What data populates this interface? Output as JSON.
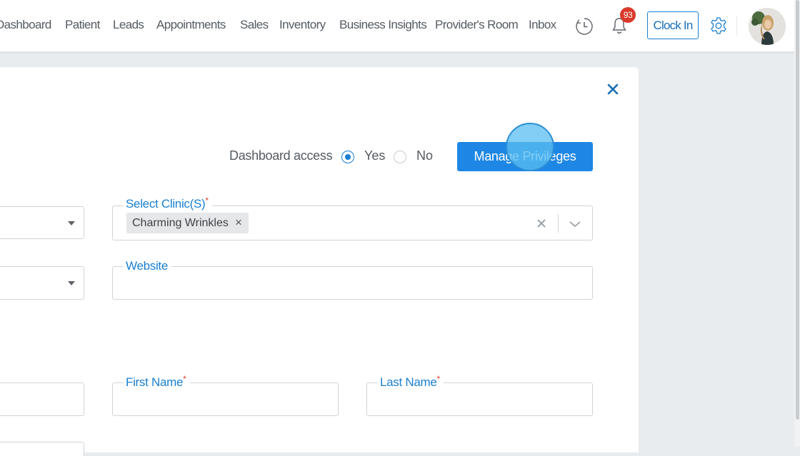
{
  "nav": {
    "items": [
      {
        "id": "dashboard",
        "label": "Dashboard"
      },
      {
        "id": "patient",
        "label": "Patient"
      },
      {
        "id": "leads",
        "label": "Leads"
      },
      {
        "id": "appointments",
        "label": "Appointments"
      },
      {
        "id": "sales",
        "label": "Sales"
      },
      {
        "id": "inventory",
        "label": "Inventory"
      },
      {
        "id": "business-insights",
        "label": "Business Insights"
      },
      {
        "id": "providers-room",
        "label": "Provider's Room"
      },
      {
        "id": "inbox",
        "label": "Inbox"
      }
    ],
    "notification_count": "93",
    "clock_in_label": "Clock In",
    "icons": {
      "history": "clock-history-icon",
      "notifications": "bell-icon",
      "settings": "gear-icon",
      "avatar": "user-avatar"
    }
  },
  "modal": {
    "dashboard_access": {
      "label": "Dashboard access",
      "options": [
        {
          "label": "Yes",
          "checked": true
        },
        {
          "label": "No",
          "checked": false
        }
      ]
    },
    "manage_button_label": "Manage Privileges",
    "clinics": {
      "label": "Select Clinic(S)",
      "required": "*",
      "selected": [
        "Charming Wrinkles"
      ]
    },
    "website": {
      "label": "Website",
      "value": ""
    },
    "first_name": {
      "label": "First Name",
      "required": "*",
      "value": ""
    },
    "last_name": {
      "label": "Last Name",
      "required": "*",
      "value": ""
    }
  },
  "colors": {
    "accent": "#1e87e6",
    "badge": "#d93a2b",
    "label": "#1a7fd1"
  }
}
